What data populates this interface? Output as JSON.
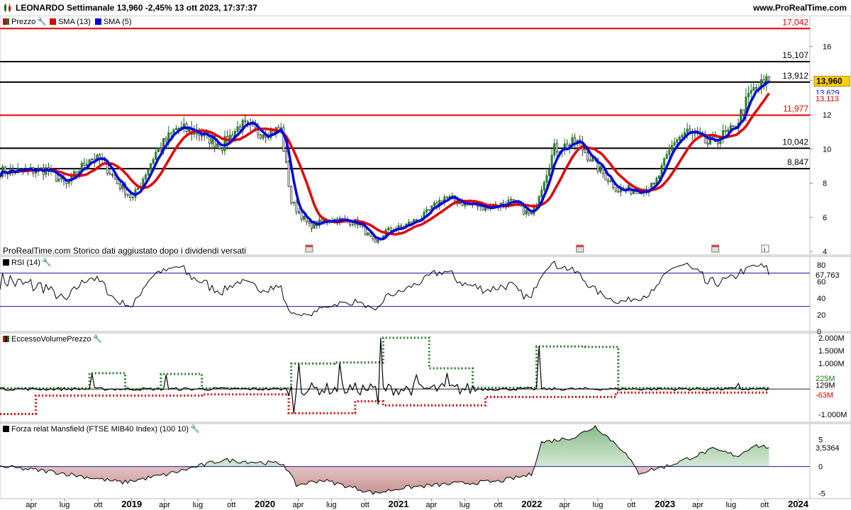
{
  "header": {
    "title": "LEONARDO Settimanale 13,960 -2,45% 13 ott 2023, 17:37:37",
    "site": "www.ProRealTime.com"
  },
  "colors": {
    "up": "#1f6f1f",
    "down": "#333333",
    "sma13": "#e00000",
    "sma5": "#0000e0",
    "level_red": "#e00000",
    "level_black": "#000000",
    "rsi_band": "#1a1aa0",
    "mansfield_pos": "#2e7d2e",
    "mansfield_neg": "#a05050"
  },
  "icons": {
    "logo": "candlestick-logo-icon",
    "wrench": "wrench-icon",
    "calendar": "calendar-icon",
    "info": "info-icon"
  },
  "legends": {
    "price": [
      {
        "label": "Prezzo"
      },
      {
        "label": "SMA (13)"
      },
      {
        "label": "SMA (5)"
      }
    ],
    "rsi": "RSI (14)",
    "volume": "EccessoVolumePrezzo",
    "mansfield": "Forza relat Mansfield (FTSE MIB40 Index) (100 10)"
  },
  "note": "ProRealTime.com  Storico dati aggiustato dopo i dividendi versati",
  "chart_data": [
    {
      "type": "candlestick",
      "ylim": [
        3.8,
        17.8
      ],
      "y_ticks": [
        "4",
        "6",
        "8",
        "10",
        "12",
        "14",
        "16"
      ],
      "x_ticks": [
        "apr",
        "lug",
        "ott",
        "2019",
        "apr",
        "lug",
        "ott",
        "2020",
        "apr",
        "lug",
        "ott",
        "2021",
        "apr",
        "lug",
        "ott",
        "2022",
        "apr",
        "lug",
        "ott",
        "2023",
        "apr",
        "lug",
        "ott",
        "2024"
      ],
      "x_ticks_bold": [
        "2019",
        "2020",
        "2021",
        "2022",
        "2023",
        "2024"
      ],
      "close_anchor_dates": [
        "2018-03-16",
        "2018-05-11",
        "2018-07-06",
        "2018-09-07",
        "2018-10-12",
        "2018-11-23",
        "2019-01-04",
        "2019-03-08",
        "2019-05-03",
        "2019-06-28",
        "2019-09-06",
        "2019-10-25",
        "2019-12-13",
        "2020-02-14",
        "2020-03-13",
        "2020-05-01",
        "2020-07-03",
        "2020-09-11",
        "2020-10-30",
        "2020-11-27",
        "2021-01-08",
        "2021-03-12",
        "2021-05-07",
        "2021-07-02",
        "2021-09-03",
        "2021-11-05",
        "2021-12-31",
        "2022-03-04",
        "2022-05-06",
        "2022-07-01",
        "2022-08-26",
        "2022-10-07",
        "2022-12-02",
        "2023-01-27",
        "2023-03-03",
        "2023-04-28",
        "2023-06-02",
        "2023-07-07",
        "2023-08-25",
        "2023-09-29",
        "2023-10-13"
      ],
      "close_anchor_values": [
        8.7,
        8.8,
        7.9,
        9.5,
        9.3,
        8.0,
        7.1,
        9.8,
        11.2,
        11.0,
        10.2,
        11.4,
        11.0,
        11.1,
        6.9,
        5.5,
        5.9,
        5.7,
        4.4,
        5.2,
        5.4,
        6.1,
        7.2,
        6.8,
        6.6,
        6.9,
        6.1,
        10.0,
        10.4,
        8.9,
        7.6,
        7.6,
        7.8,
        10.5,
        11.0,
        10.3,
        10.7,
        11.1,
        13.3,
        13.8,
        13.96
      ],
      "levels": [
        {
          "value": 17.042,
          "label": "17,042",
          "color": "#e00000"
        },
        {
          "value": 15.107,
          "label": "15,107",
          "color": "#000000"
        },
        {
          "value": 13.912,
          "label": "13,912",
          "color": "#000000"
        },
        {
          "value": 11.977,
          "label": "11,977",
          "color": "#e00000"
        },
        {
          "value": 10.042,
          "label": "10,042",
          "color": "#000000"
        },
        {
          "value": 8.847,
          "label": "8,847",
          "color": "#000000"
        }
      ],
      "last_price": {
        "value": 13.96,
        "label": "13,960"
      },
      "sma5_last": {
        "value": 13.629,
        "label": "13,629"
      },
      "sma13_last": {
        "value": 13.113,
        "label": "13,113"
      }
    },
    {
      "type": "line",
      "name": "RSI (14)",
      "ylim": [
        0,
        90
      ],
      "y_ticks": [
        "0",
        "20",
        "40",
        "60",
        "80"
      ],
      "bands": [
        30,
        70
      ],
      "last": {
        "value": 67.763,
        "label": "67,763"
      }
    },
    {
      "type": "line",
      "name": "EccessoVolumePrezzo",
      "ylim": [
        -1300,
        2200
      ],
      "y_ticks": [
        "-1.000M",
        "1.000M",
        "1.500M",
        "2.000M"
      ],
      "upper_steps": [
        {
          "from": "2018-01-05",
          "to": "2018-09-07",
          "value": 30
        },
        {
          "from": "2018-09-07",
          "to": "2018-12-14",
          "value": 620
        },
        {
          "from": "2018-12-14",
          "to": "2019-03-22",
          "value": 0
        },
        {
          "from": "2019-03-22",
          "to": "2019-07-12",
          "value": 590
        },
        {
          "from": "2019-07-12",
          "to": "2020-03-13",
          "value": 30
        },
        {
          "from": "2020-03-13",
          "to": "2020-07-10",
          "value": 1000
        },
        {
          "from": "2020-07-10",
          "to": "2020-11-20",
          "value": 1040
        },
        {
          "from": "2020-11-20",
          "to": "2021-03-26",
          "value": 2010
        },
        {
          "from": "2021-03-26",
          "to": "2021-07-23",
          "value": 810
        },
        {
          "from": "2021-07-23",
          "to": "2022-01-14",
          "value": 50
        },
        {
          "from": "2022-01-14",
          "to": "2022-05-27",
          "value": 1670
        },
        {
          "from": "2022-05-27",
          "to": "2022-08-26",
          "value": 1650
        },
        {
          "from": "2022-08-26",
          "to": "2023-10-13",
          "value": 40
        }
      ],
      "lower_steps": [
        {
          "from": "2018-01-05",
          "to": "2018-04-13",
          "value": -980
        },
        {
          "from": "2018-04-13",
          "to": "2019-07-12",
          "value": -260
        },
        {
          "from": "2019-07-12",
          "to": "2020-03-06",
          "value": -210
        },
        {
          "from": "2020-03-06",
          "to": "2020-09-04",
          "value": -950
        },
        {
          "from": "2020-09-04",
          "to": "2020-11-20",
          "value": -480
        },
        {
          "from": "2020-11-20",
          "to": "2021-08-27",
          "value": -640
        },
        {
          "from": "2021-08-27",
          "to": "2022-08-19",
          "value": -310
        },
        {
          "from": "2022-08-19",
          "to": "2023-10-13",
          "value": -140
        }
      ],
      "spikes": [
        {
          "date": "2018-09-14",
          "value": 600
        },
        {
          "date": "2019-04-05",
          "value": 550
        },
        {
          "date": "2020-03-20",
          "value": -950
        },
        {
          "date": "2020-04-03",
          "value": 1000
        },
        {
          "date": "2020-07-24",
          "value": 1020
        },
        {
          "date": "2020-11-13",
          "value": 2000
        },
        {
          "date": "2020-11-06",
          "value": -600
        },
        {
          "date": "2021-02-19",
          "value": 560
        },
        {
          "date": "2021-05-14",
          "value": 620
        },
        {
          "date": "2022-01-21",
          "value": 1680
        },
        {
          "date": "2023-07-21",
          "value": 220
        }
      ],
      "last_values": [
        {
          "value": 225,
          "label": "225M"
        },
        {
          "value": 129,
          "label": "129M"
        },
        {
          "value": -63,
          "label": "-63M"
        }
      ]
    },
    {
      "type": "area",
      "name": "Forza relat Mansfield (FTSE MIB40 Index) (100 10)",
      "ylim": [
        -6,
        8
      ],
      "y_ticks": [
        "-5",
        "0",
        "5"
      ],
      "anchor_dates": [
        "2018-01-05",
        "2018-06-01",
        "2018-12-07",
        "2019-04-05",
        "2019-09-06",
        "2019-12-13",
        "2020-02-21",
        "2020-03-27",
        "2020-06-05",
        "2020-10-30",
        "2021-01-08",
        "2021-06-04",
        "2021-10-01",
        "2021-12-31",
        "2022-01-28",
        "2022-04-29",
        "2022-06-24",
        "2022-09-09",
        "2022-10-21",
        "2023-01-13",
        "2023-05-12",
        "2023-07-21",
        "2023-09-01",
        "2023-10-13"
      ],
      "anchor_values": [
        0.0,
        -1.0,
        -3.0,
        -1.5,
        1.2,
        0.8,
        0.5,
        -3.5,
        -2.5,
        -5.0,
        -4.0,
        -3.2,
        -2.8,
        -1.5,
        4.5,
        5.5,
        7.5,
        3.0,
        -1.2,
        0.2,
        3.2,
        2.0,
        4.0,
        3.5364
      ],
      "last": {
        "value": 3.5364,
        "label": "3,5364"
      }
    }
  ]
}
